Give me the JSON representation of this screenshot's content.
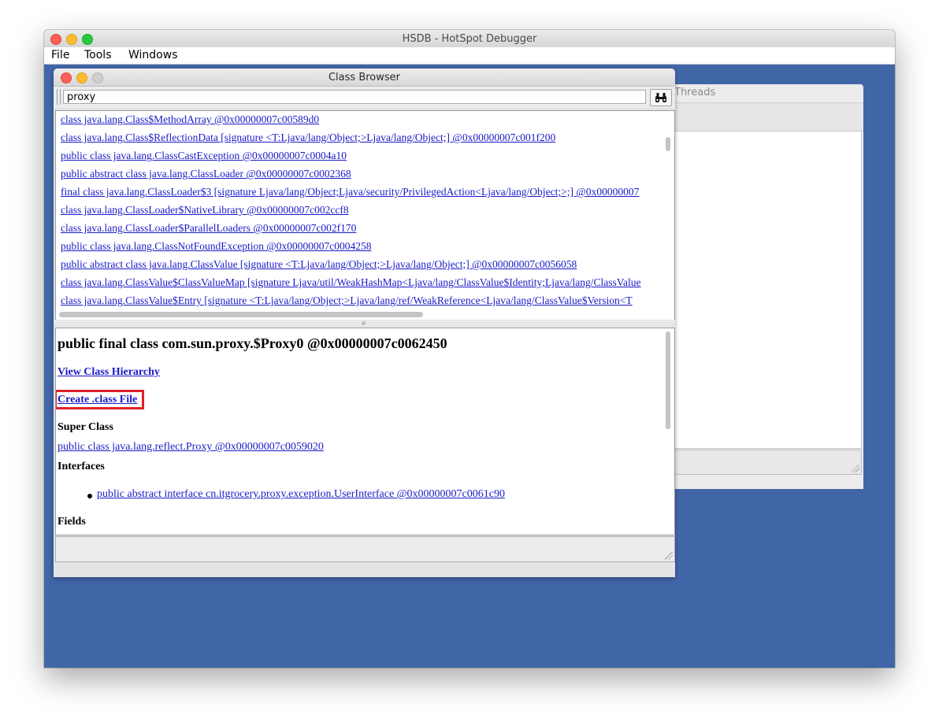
{
  "window": {
    "title": "HSDB - HotSpot Debugger",
    "traffic_lights": [
      "#fe5f57",
      "#febc2e",
      "#28c840"
    ]
  },
  "menubar": {
    "items": [
      "File",
      "Tools",
      "Windows"
    ]
  },
  "background_frame": {
    "tab_label": "Threads"
  },
  "class_browser": {
    "title": "Class Browser",
    "search": {
      "value": "proxy"
    },
    "find_icon": "binoculars-icon",
    "class_list": [
      "class java.lang.Class$MethodArray @0x00000007c00589d0",
      "class java.lang.Class$ReflectionData [signature <T:Ljava/lang/Object;>Ljava/lang/Object;] @0x00000007c001f200",
      "public class java.lang.ClassCastException @0x00000007c0004a10",
      "public abstract class java.lang.ClassLoader @0x00000007c0002368",
      "final class java.lang.ClassLoader$3 [signature Ljava/lang/Object;Ljava/security/PrivilegedAction<Ljava/lang/Object;>;] @0x00000007",
      "class java.lang.ClassLoader$NativeLibrary @0x00000007c002ccf8",
      "class java.lang.ClassLoader$ParallelLoaders @0x00000007c002f170",
      "public class java.lang.ClassNotFoundException @0x00000007c0004258",
      "public abstract class java.lang.ClassValue [signature <T:Ljava/lang/Object;>Ljava/lang/Object;] @0x00000007c0056058",
      "class java.lang.ClassValue$ClassValueMap [signature Ljava/util/WeakHashMap<Ljava/lang/ClassValue$Identity;Ljava/lang/ClassValue",
      "class java.lang.ClassValue$Entry [signature <T:Ljava/lang/Object;>Ljava/lang/ref/WeakReference<Ljava/lang/ClassValue$Version<T"
    ],
    "detail": {
      "heading": "public final class com.sun.proxy.$Proxy0 @0x00000007c0062450",
      "view_hierarchy": "View Class Hierarchy",
      "create_class_file": "Create .class File",
      "super_class_label": "Super Class",
      "super_class": "public class java.lang.reflect.Proxy @0x00000007c0059020",
      "interfaces_label": "Interfaces",
      "interfaces": [
        "public abstract interface cn.itgrocery.proxy.exception.UserInterface @0x00000007c0061c90"
      ],
      "fields_label": "Fields"
    },
    "highlight_color": "#e0202a",
    "link_color": "#1a1ac8"
  },
  "desktop_color": "#4166a8"
}
